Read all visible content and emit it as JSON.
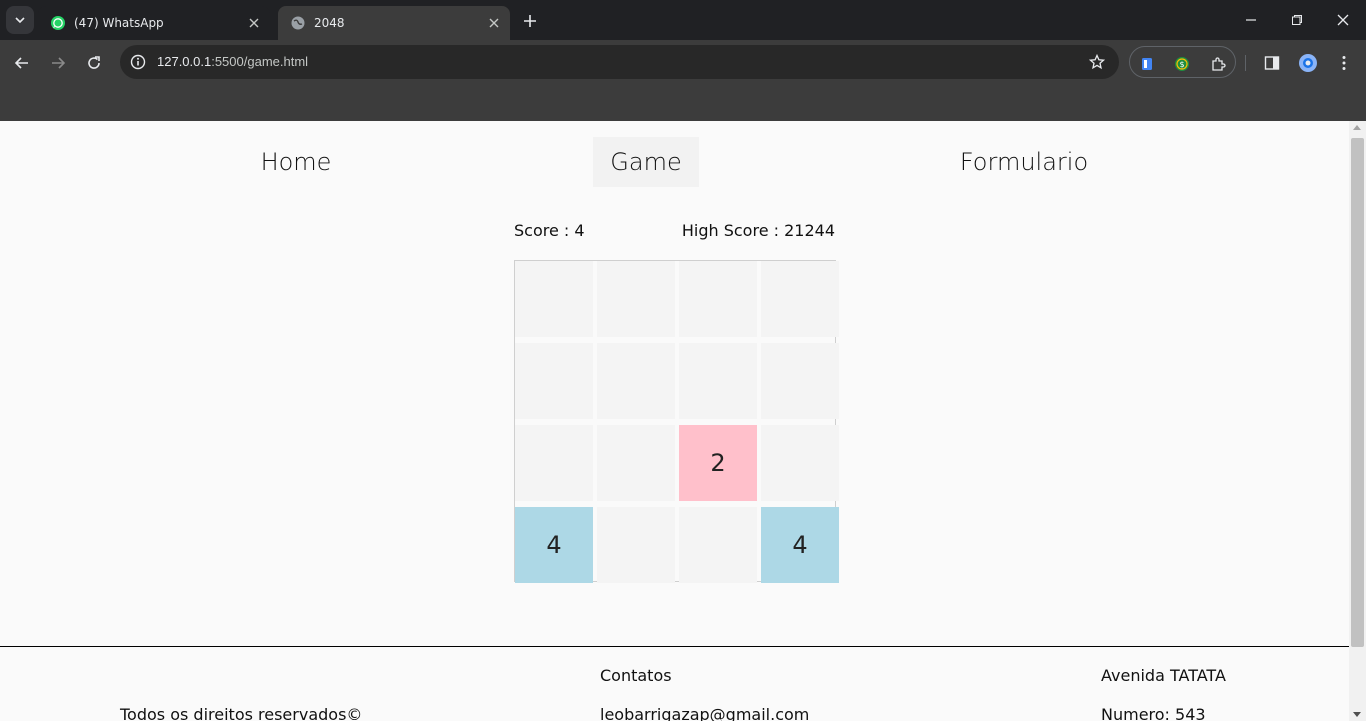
{
  "browser": {
    "tabs": [
      {
        "title": "(47) WhatsApp",
        "active": false
      },
      {
        "title": "2048",
        "active": true
      }
    ],
    "url_host": "127.0.0.1",
    "url_path": ":5500/game.html"
  },
  "nav": {
    "home": "Home",
    "game": "Game",
    "form": "Formulario"
  },
  "scores": {
    "score": "Score : 4",
    "high_score": "High Score : 21244"
  },
  "board": {
    "rows": [
      [
        "",
        "",
        "",
        ""
      ],
      [
        "",
        "",
        "",
        ""
      ],
      [
        "",
        "",
        "2",
        ""
      ],
      [
        "4",
        "",
        "",
        "4"
      ]
    ],
    "tile_colors": {
      "2": "#ffc0cb",
      "4": "#add8e6"
    }
  },
  "footer": {
    "rights": "Todos os direitos reservados©",
    "contacts_title": "Contatos",
    "email": "leobarrigazap@gmail.com",
    "address": "Avenida TATATA",
    "number": "Numero: 543"
  }
}
